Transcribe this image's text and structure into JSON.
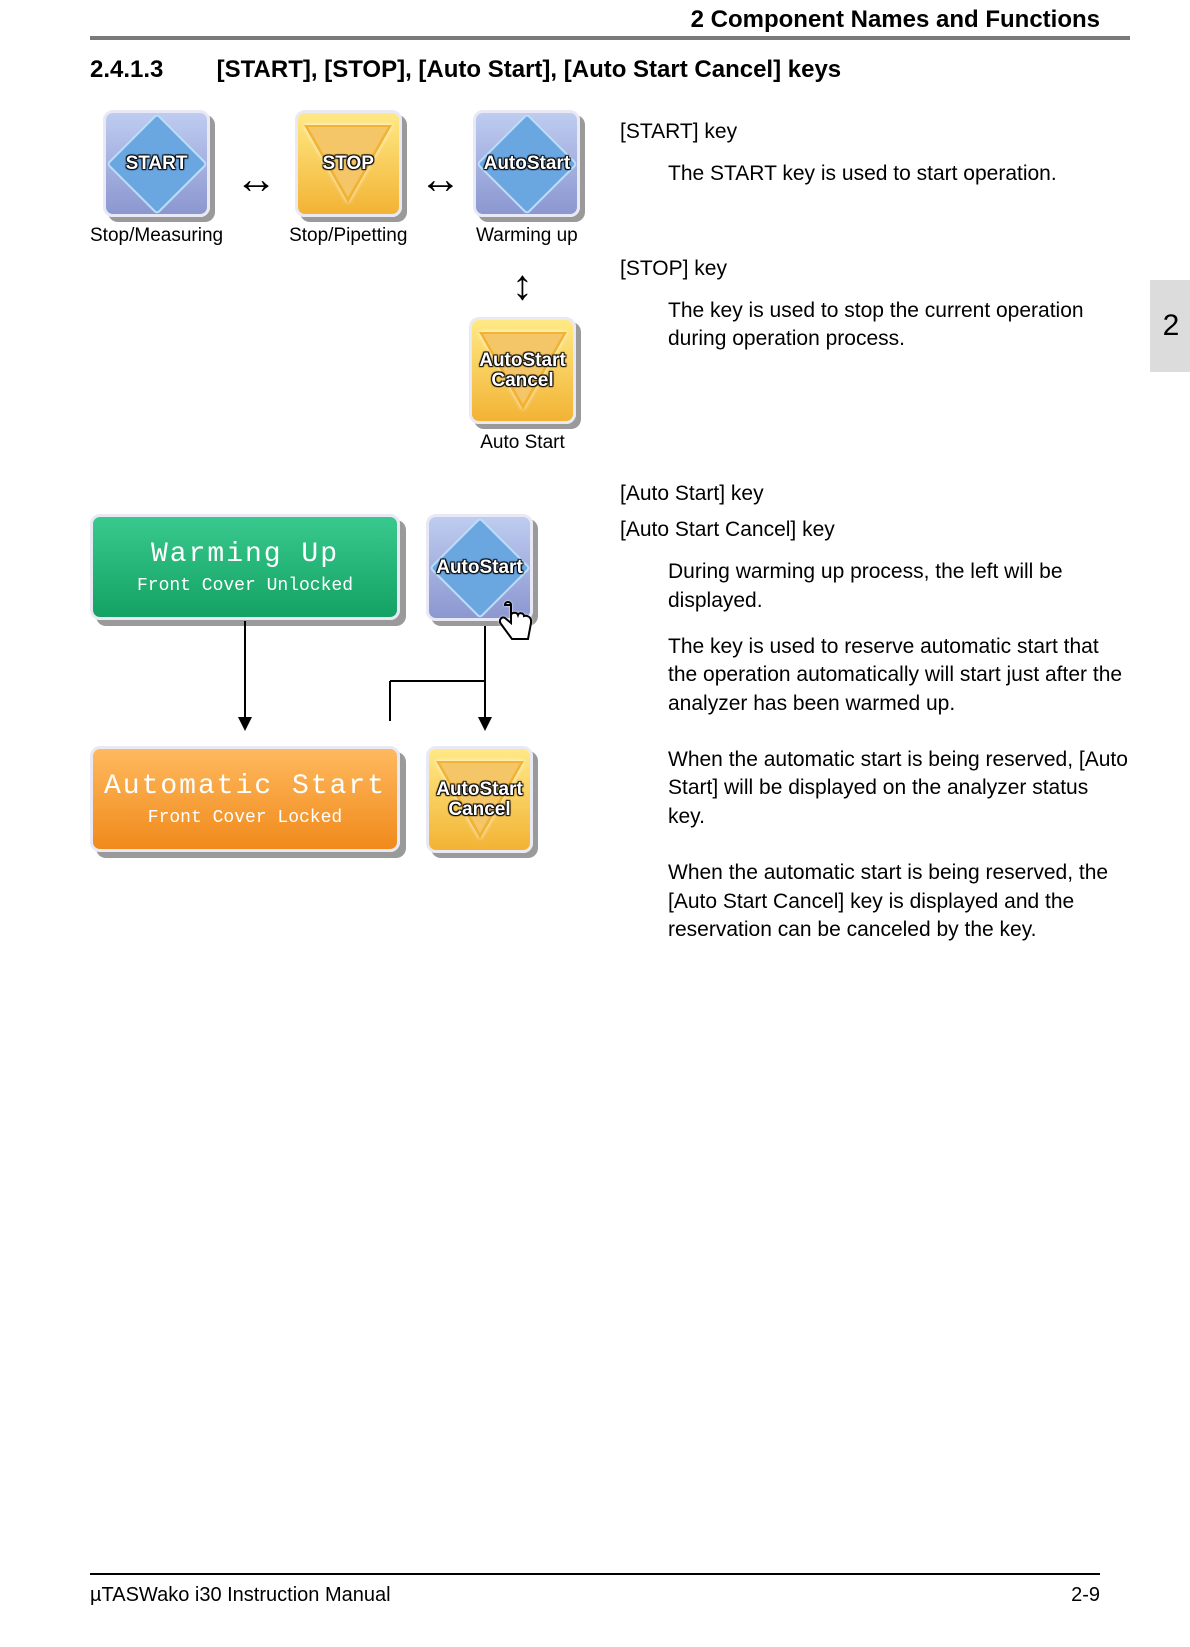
{
  "header": {
    "chapter": "2 Component Names and Functions"
  },
  "section": {
    "number": "2.4.1.3",
    "title": "[START], [STOP], [Auto Start], [Auto Start Cancel] keys"
  },
  "keys": {
    "start": "START",
    "stop": "STOP",
    "autostart": "AutoStart",
    "autostart_cancel_l1": "AutoStart",
    "autostart_cancel_l2": "Cancel"
  },
  "captions": {
    "stop_measuring": "Stop/Measuring",
    "stop_pipetting": "Stop/Pipetting",
    "warming_up": "Warming up",
    "auto_start": "Auto Start"
  },
  "status": {
    "warming_l1": "Warming Up",
    "warming_l2": "Front Cover Unlocked",
    "auto_l1": "Automatic Start",
    "auto_l2": "Front Cover Locked"
  },
  "descriptions": {
    "start_h": "[START] key",
    "start_p": "The START key is used to start operation.",
    "stop_h": "[STOP] key",
    "stop_p": "The key is used to stop the current operation during operation process.",
    "auto_h1": "[Auto Start] key",
    "auto_h2": "[Auto Start Cancel] key",
    "auto_p1": "During warming up process, the left will be displayed.",
    "auto_p2": "The key is used to reserve automatic start that the operation automatically will start just after the analyzer has been warmed up.",
    "auto_p3": "When the automatic start is being reserved, [Auto Start] will be displayed on the analyzer status key.",
    "auto_p4": "When the automatic start is being reserved, the [Auto Start Cancel] key is displayed and the reservation can be canceled by the key."
  },
  "tab": "2",
  "footer": {
    "left": "µTASWako i30  Instruction Manual",
    "right": "2-9"
  }
}
